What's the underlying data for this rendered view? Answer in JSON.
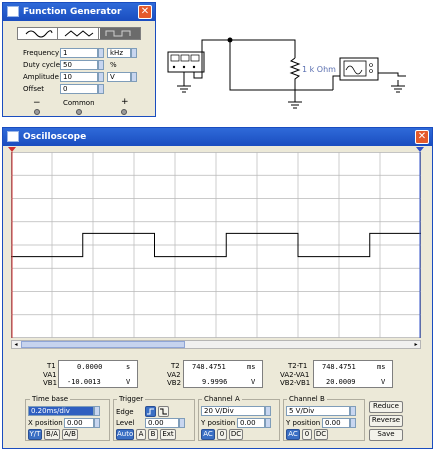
{
  "function_generator": {
    "title": "Function Generator",
    "close": "✕",
    "params": [
      {
        "label": "Frequency",
        "value": "1",
        "unit": "kHz"
      },
      {
        "label": "Duty cycle",
        "value": "50",
        "unit": "%"
      },
      {
        "label": "Amplitude",
        "value": "10",
        "unit": "V"
      },
      {
        "label": "Offset",
        "value": "0",
        "unit": ""
      }
    ],
    "terminals": {
      "minus": "−",
      "common": "Common",
      "plus": "+"
    }
  },
  "circuit": {
    "resistor_label": "1 k Ohm"
  },
  "oscilloscope": {
    "title": "Oscilloscope",
    "close": "✕",
    "grid": {
      "cols": 10,
      "rows": 8
    },
    "waveform": {
      "low": -10,
      "high": 10,
      "volts_per_div": 20
    },
    "readouts": {
      "t1_label": "T1",
      "t1_value": "0.0000",
      "t1_unit": "s",
      "va1_label": "VA1",
      "vb1_label": "VB1",
      "vb1_value": "-10.0013",
      "vb1_unit": "V",
      "t2_label": "T2",
      "t2_value": "748.4751",
      "t2_unit": "ms",
      "va2_label": "VA2",
      "vb2_label": "VB2",
      "vb2_value": "9.9996",
      "vb2_unit": "V",
      "dt_label": "T2-T1",
      "dt_value": "748.4751",
      "dt_unit": "ms",
      "dva_label": "VA2-VA1",
      "dvb_label": "VB2-VB1",
      "dvb_value": "20.0009",
      "dvb_unit": "V"
    },
    "timebase": {
      "title": "Time base",
      "value": "0.20ms/div",
      "xpos_label": "X position",
      "xpos_value": "0.00",
      "modes": [
        "Y/T",
        "B/A",
        "A/B"
      ]
    },
    "trigger": {
      "title": "Trigger",
      "edge_label": "Edge",
      "level_label": "Level",
      "level_value": "0.00",
      "sources": [
        "Auto",
        "A",
        "B",
        "Ext"
      ]
    },
    "channel_a": {
      "title": "Channel A",
      "value": "20 V/Div",
      "ypos_label": "Y position",
      "ypos_value": "0.00",
      "coupling": [
        "AC",
        "0",
        "DC"
      ]
    },
    "channel_b": {
      "title": "Channel B",
      "value": "5 V/Div",
      "ypos_label": "Y position",
      "ypos_value": "0.00",
      "coupling": [
        "AC",
        "0",
        "DC"
      ]
    },
    "buttons": {
      "reduce": "Reduce",
      "reverse": "Reverse",
      "save": "Save"
    }
  }
}
